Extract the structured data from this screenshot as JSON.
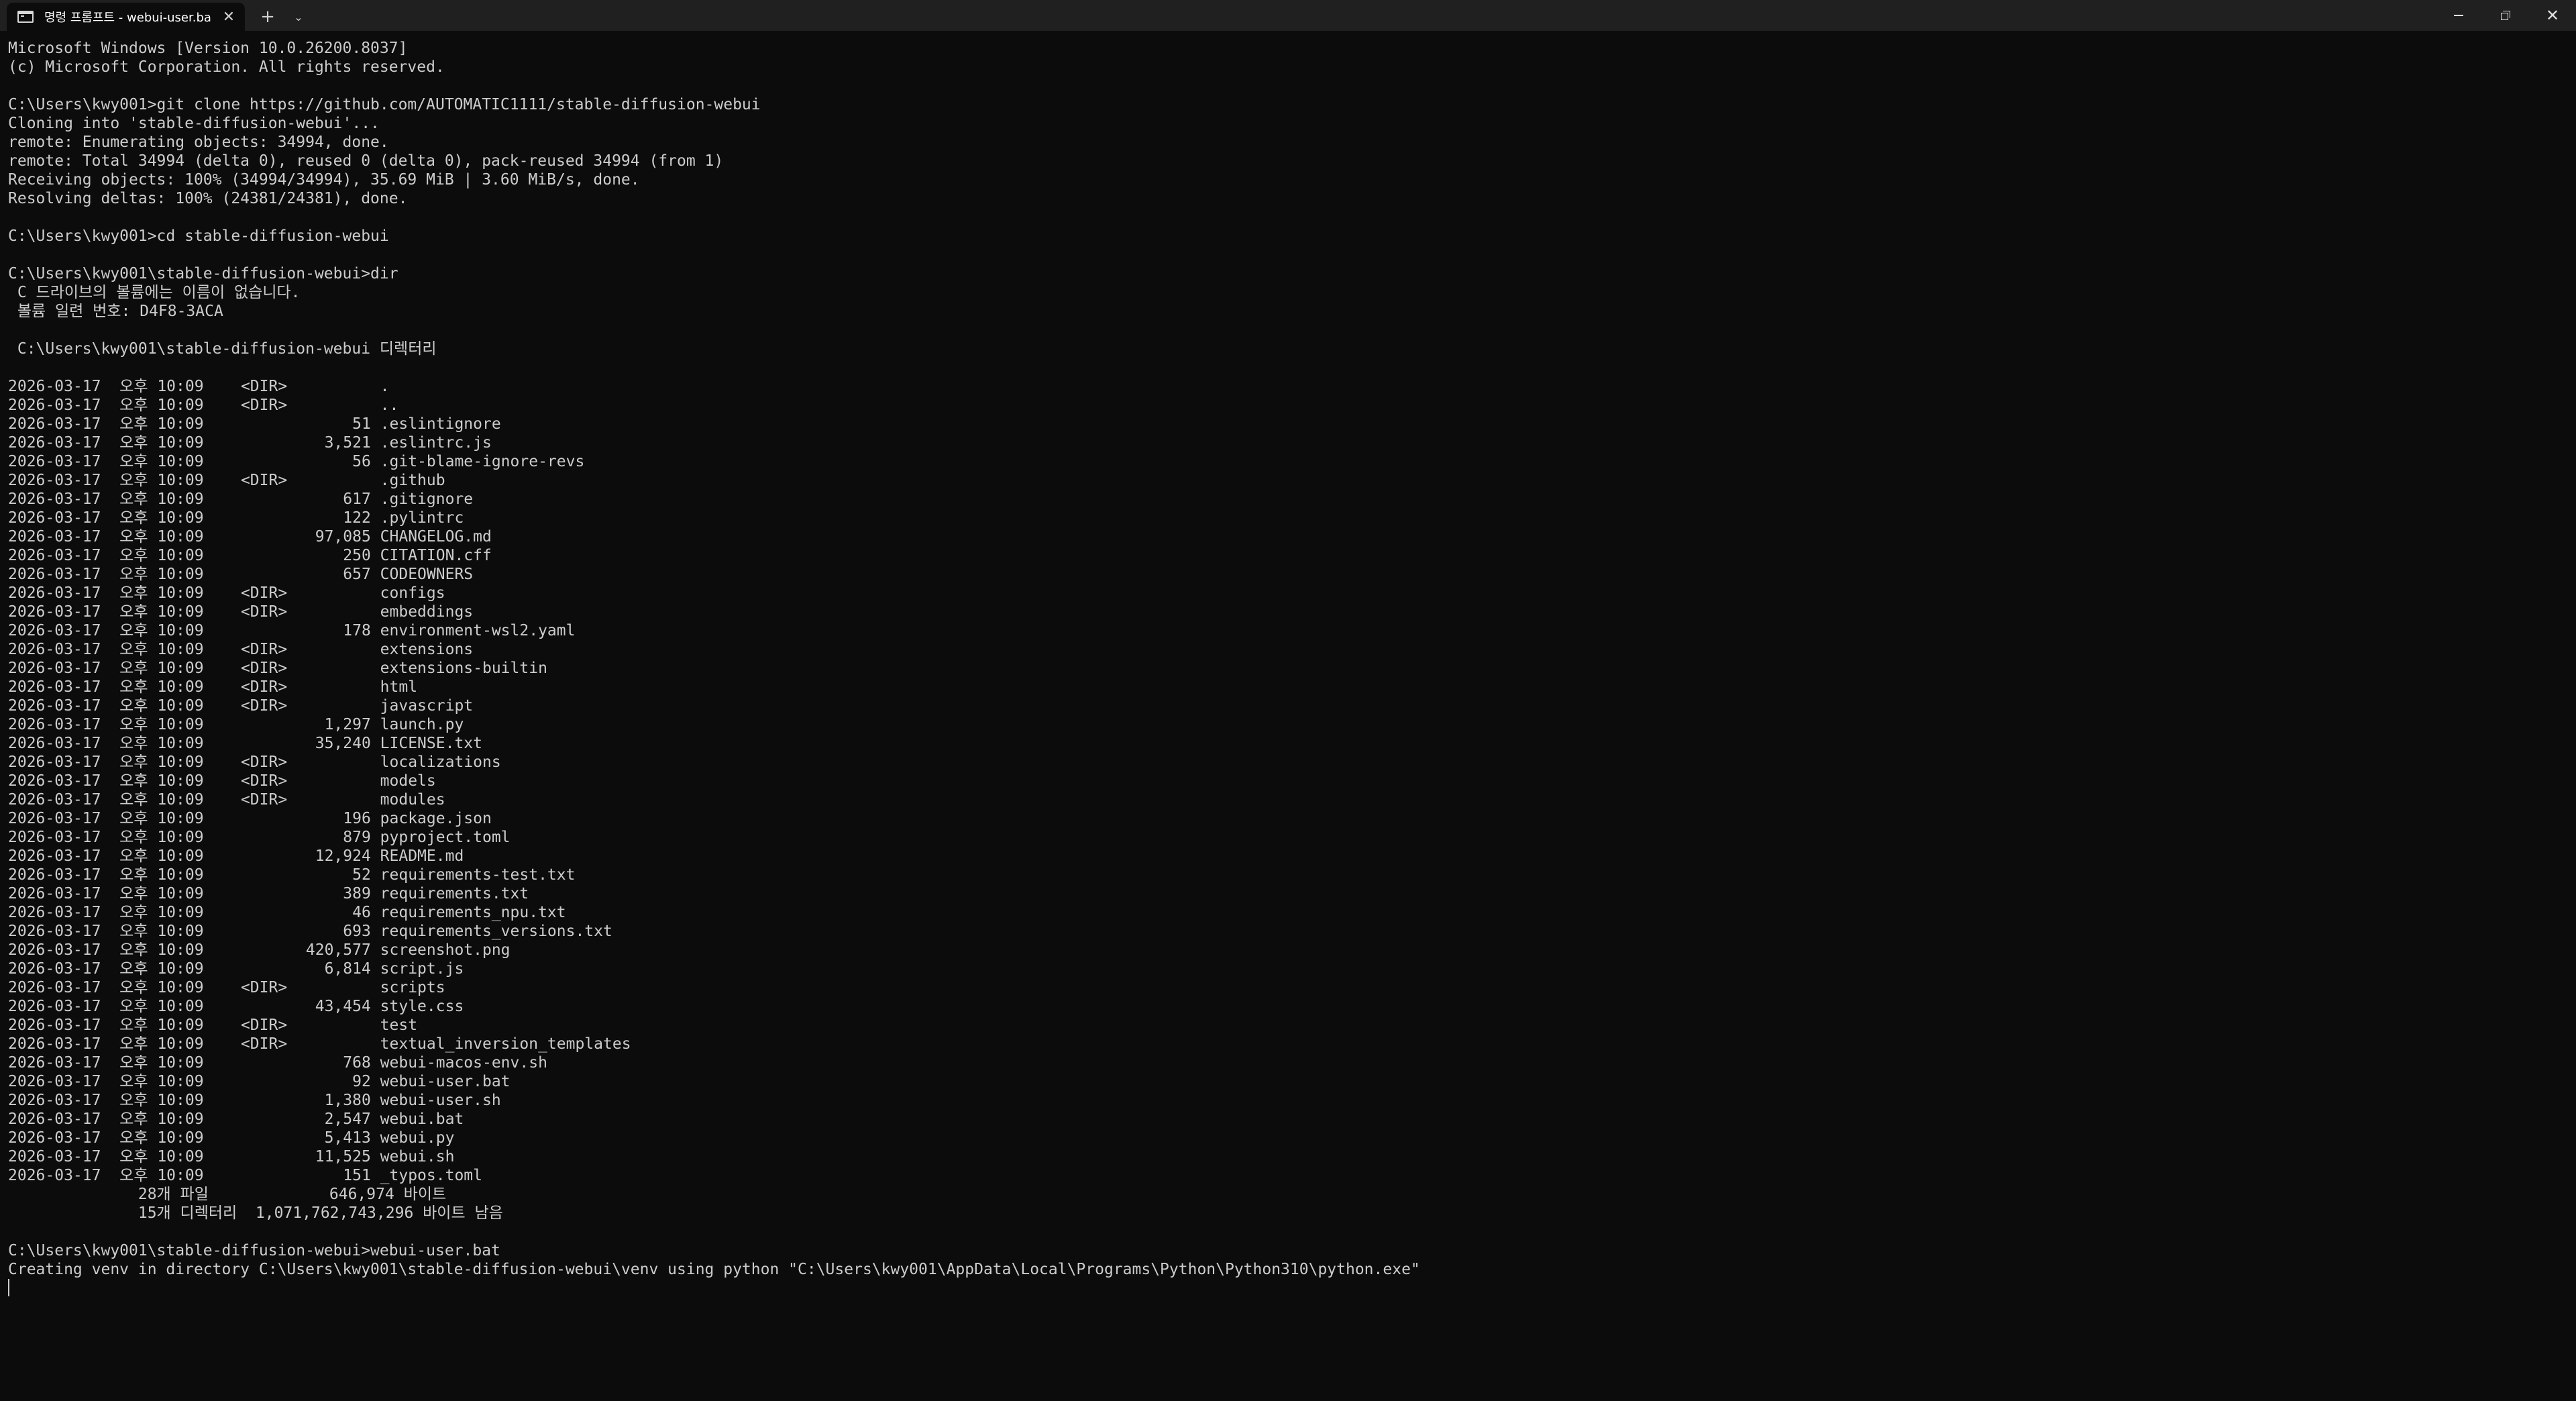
{
  "tab": {
    "title": "명령 프롬프트 - webui-user.ba",
    "icon": "terminal-icon",
    "close_glyph": "✕"
  },
  "titlebar": {
    "new_tab_glyph": "+",
    "dropdown_glyph": "⌄",
    "close_glyph": "✕"
  },
  "terminal": {
    "lines": [
      "Microsoft Windows [Version 10.0.26200.8037]",
      "(c) Microsoft Corporation. All rights reserved.",
      "",
      "C:\\Users\\kwy001>git clone https://github.com/AUTOMATIC1111/stable-diffusion-webui",
      "Cloning into 'stable-diffusion-webui'...",
      "remote: Enumerating objects: 34994, done.",
      "remote: Total 34994 (delta 0), reused 0 (delta 0), pack-reused 34994 (from 1)",
      "Receiving objects: 100% (34994/34994), 35.69 MiB | 3.60 MiB/s, done.",
      "Resolving deltas: 100% (24381/24381), done.",
      "",
      "C:\\Users\\kwy001>cd stable-diffusion-webui",
      "",
      "C:\\Users\\kwy001\\stable-diffusion-webui>dir",
      " C 드라이브의 볼륨에는 이름이 없습니다.",
      " 볼륨 일련 번호: D4F8-3ACA",
      "",
      " C:\\Users\\kwy001\\stable-diffusion-webui 디렉터리",
      "",
      "2026-03-17  오후 10:09    <DIR>          .",
      "2026-03-17  오후 10:09    <DIR>          ..",
      "2026-03-17  오후 10:09                51 .eslintignore",
      "2026-03-17  오후 10:09             3,521 .eslintrc.js",
      "2026-03-17  오후 10:09                56 .git-blame-ignore-revs",
      "2026-03-17  오후 10:09    <DIR>          .github",
      "2026-03-17  오후 10:09               617 .gitignore",
      "2026-03-17  오후 10:09               122 .pylintrc",
      "2026-03-17  오후 10:09            97,085 CHANGELOG.md",
      "2026-03-17  오후 10:09               250 CITATION.cff",
      "2026-03-17  오후 10:09               657 CODEOWNERS",
      "2026-03-17  오후 10:09    <DIR>          configs",
      "2026-03-17  오후 10:09    <DIR>          embeddings",
      "2026-03-17  오후 10:09               178 environment-wsl2.yaml",
      "2026-03-17  오후 10:09    <DIR>          extensions",
      "2026-03-17  오후 10:09    <DIR>          extensions-builtin",
      "2026-03-17  오후 10:09    <DIR>          html",
      "2026-03-17  오후 10:09    <DIR>          javascript",
      "2026-03-17  오후 10:09             1,297 launch.py",
      "2026-03-17  오후 10:09            35,240 LICENSE.txt",
      "2026-03-17  오후 10:09    <DIR>          localizations",
      "2026-03-17  오후 10:09    <DIR>          models",
      "2026-03-17  오후 10:09    <DIR>          modules",
      "2026-03-17  오후 10:09               196 package.json",
      "2026-03-17  오후 10:09               879 pyproject.toml",
      "2026-03-17  오후 10:09            12,924 README.md",
      "2026-03-17  오후 10:09                52 requirements-test.txt",
      "2026-03-17  오후 10:09               389 requirements.txt",
      "2026-03-17  오후 10:09                46 requirements_npu.txt",
      "2026-03-17  오후 10:09               693 requirements_versions.txt",
      "2026-03-17  오후 10:09           420,577 screenshot.png",
      "2026-03-17  오후 10:09             6,814 script.js",
      "2026-03-17  오후 10:09    <DIR>          scripts",
      "2026-03-17  오후 10:09            43,454 style.css",
      "2026-03-17  오후 10:09    <DIR>          test",
      "2026-03-17  오후 10:09    <DIR>          textual_inversion_templates",
      "2026-03-17  오후 10:09               768 webui-macos-env.sh",
      "2026-03-17  오후 10:09                92 webui-user.bat",
      "2026-03-17  오후 10:09             1,380 webui-user.sh",
      "2026-03-17  오후 10:09             2,547 webui.bat",
      "2026-03-17  오후 10:09             5,413 webui.py",
      "2026-03-17  오후 10:09            11,525 webui.sh",
      "2026-03-17  오후 10:09               151 _typos.toml",
      "              28개 파일             646,974 바이트",
      "              15개 디렉터리  1,071,762,743,296 바이트 남음",
      "",
      "C:\\Users\\kwy001\\stable-diffusion-webui>webui-user.bat",
      "Creating venv in directory C:\\Users\\kwy001\\stable-diffusion-webui\\venv using python \"C:\\Users\\kwy001\\AppData\\Local\\Programs\\Python\\Python310\\python.exe\""
    ]
  }
}
